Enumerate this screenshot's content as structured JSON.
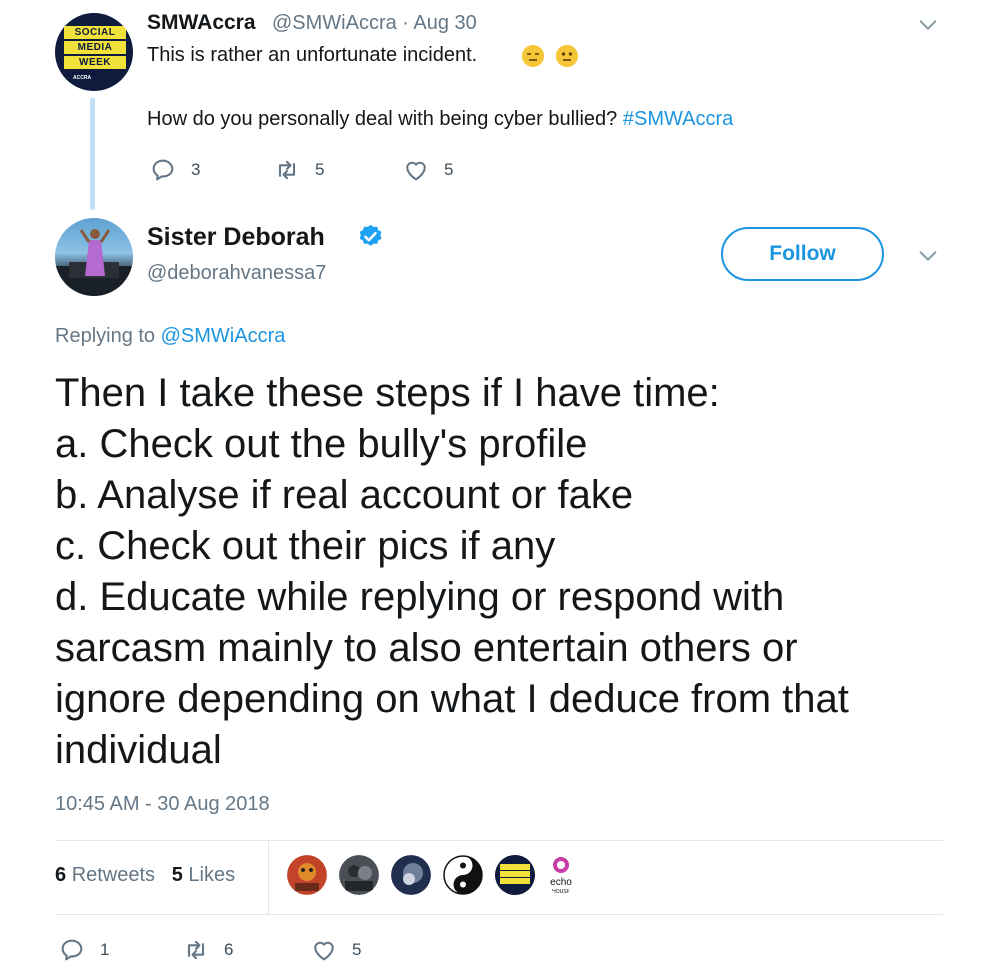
{
  "parent_tweet": {
    "avatar_label_lines": [
      "SOCIAL",
      "MEDIA",
      "WEEK"
    ],
    "avatar_sublabel": "ACCRA",
    "name": "SMWAccra",
    "handle_and_date": "@SMWiAccra · Aug 30",
    "text_line1": "This is rather an unfortunate incident.",
    "text_line2_prefix": "How do you personally deal with being cyber bullied?",
    "hashtag": "#SMWAccra",
    "replies": "3",
    "retweets": "5",
    "likes": "5"
  },
  "main_tweet": {
    "name": "Sister Deborah",
    "handle": "@deborahvanessa7",
    "follow_label": "Follow",
    "replying_prefix": "Replying to",
    "replying_to": "@SMWiAccra",
    "body_lines": [
      "Then I take these steps if I have time:",
      "a. Check out the bully's profile",
      "b. Analyse if real account or fake",
      "c. Check out their pics if any",
      "d. Educate while replying or respond with",
      "sarcasm mainly to also entertain others or",
      "ignore depending on what I deduce from that",
      "individual"
    ],
    "timestamp": "10:45 AM - 30 Aug 2018",
    "retweet_count": "6",
    "retweet_word": "Retweets",
    "like_count": "5",
    "like_word": "Likes",
    "liker_avatars": [
      "avatar-1",
      "avatar-2",
      "avatar-3",
      "yin-yang-avatar",
      "social-media-week-avatar",
      "echo-house-avatar"
    ],
    "echo_label": "echo",
    "echo_sublabel": "HOUSE",
    "actions": {
      "replies": "1",
      "retweets": "6",
      "likes": "5"
    }
  },
  "colors": {
    "accent": "#1b95e0",
    "muted": "#657786",
    "thread_line": "#c4dff5",
    "brand_yellow": "#f1e23a"
  }
}
